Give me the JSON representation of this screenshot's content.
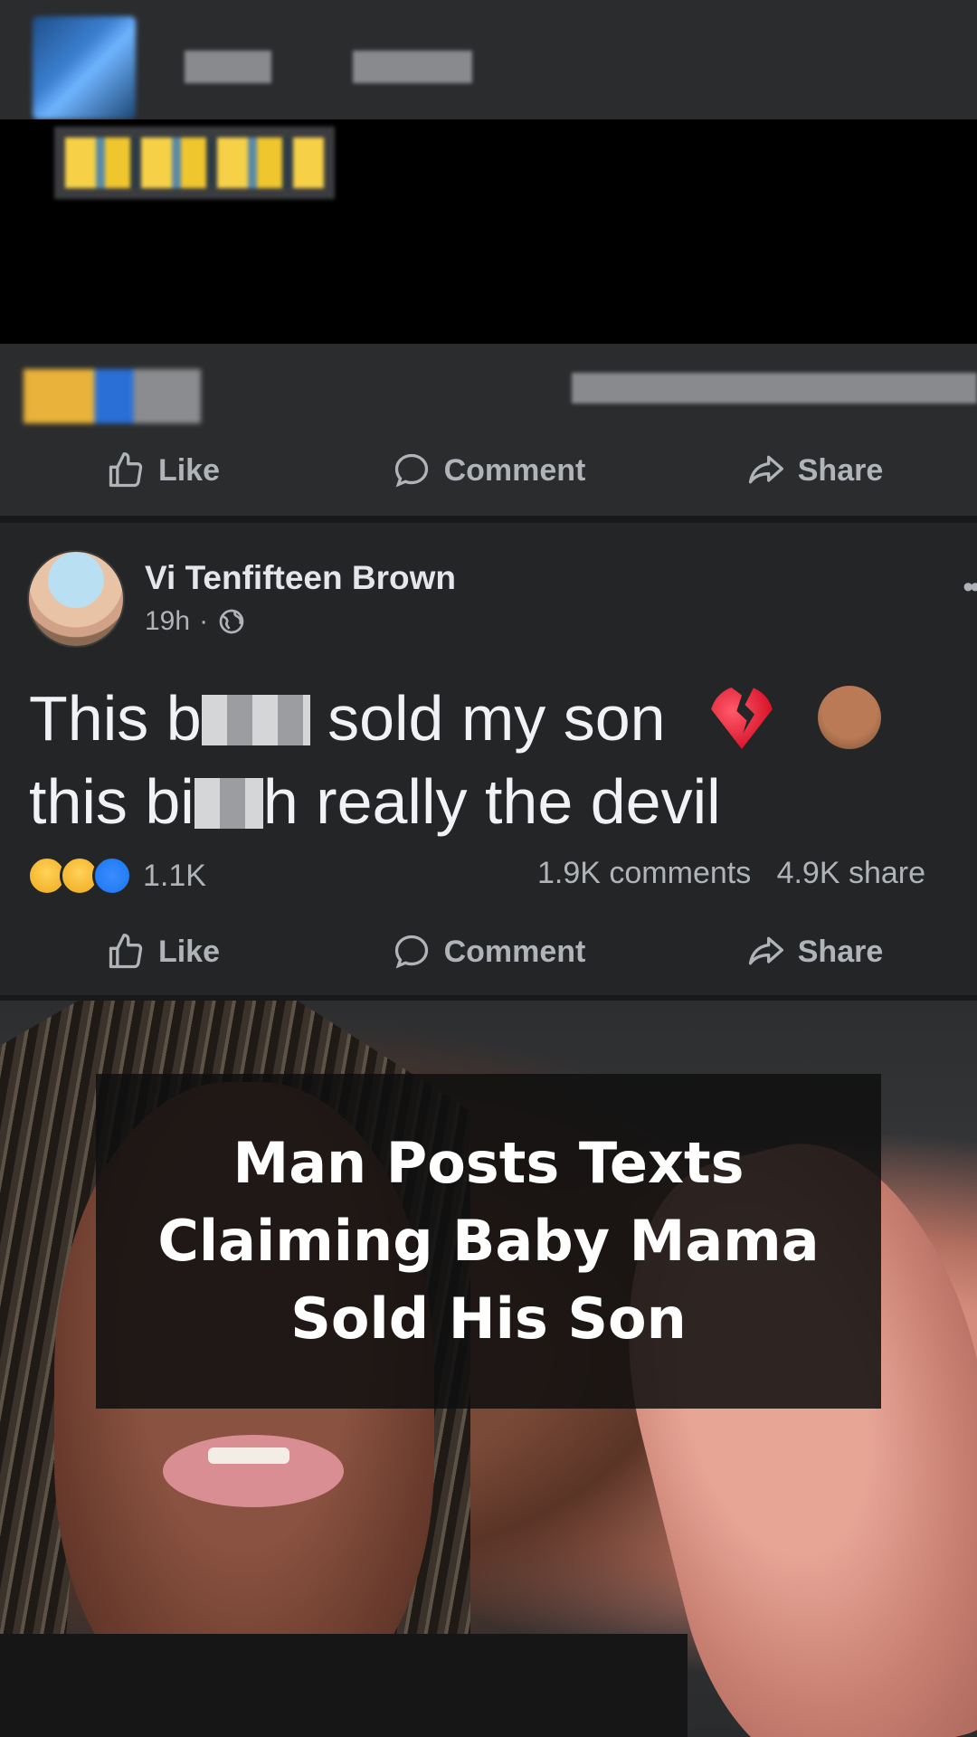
{
  "actions": {
    "like": "Like",
    "comment": "Comment",
    "share": "Share"
  },
  "post": {
    "author": "Vi Tenfifteen Brown",
    "time": "19h",
    "separator": "·",
    "visibility_icon": "globe-icon",
    "text_line1_start": "This b",
    "text_line1_end": "sold my son",
    "text_line2_start": "this bi",
    "text_line2_end": "h really the devil",
    "emoji_1": "broken-heart",
    "emoji_2": "facepalm",
    "reaction_icons": [
      "sad",
      "wow",
      "like"
    ],
    "reaction_count": "1.1K",
    "comments": "1.9K comments",
    "shares": "4.9K share"
  },
  "video": {
    "caption": "Man Posts Texts Claiming Baby Mama Sold His Son"
  },
  "colors": {
    "background": "#242526",
    "text": "#e4e6eb",
    "secondary": "#b0b3b8",
    "like_blue": "#1877f2"
  }
}
